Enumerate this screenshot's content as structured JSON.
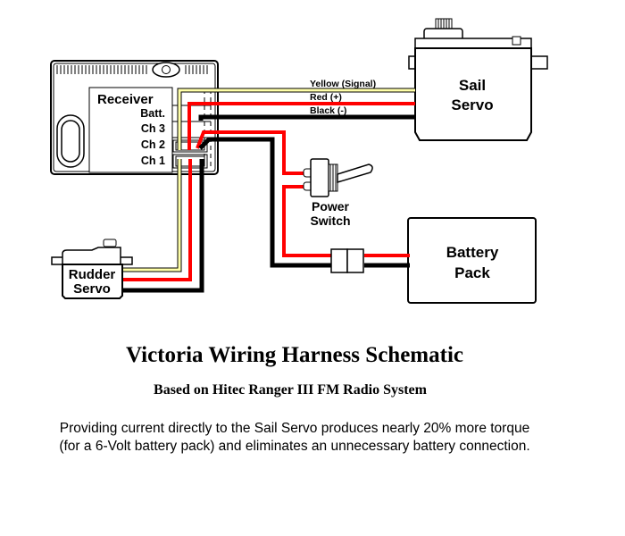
{
  "diagram": {
    "receiver": {
      "label": "Receiver",
      "ports": [
        "Batt.",
        "Ch 3",
        "Ch 2",
        "Ch 1"
      ]
    },
    "sail_servo": {
      "line1": "Sail",
      "line2": "Servo"
    },
    "rudder_servo": {
      "line1": "Rudder",
      "line2": "Servo"
    },
    "battery": {
      "line1": "Battery",
      "line2": "Pack"
    },
    "switch": {
      "line1": "Power",
      "line2": "Switch"
    },
    "wire_labels": {
      "signal": "Yellow (Signal)",
      "positive": "Red (+)",
      "negative": "Black (-)"
    },
    "colors": {
      "signal": "#ffffa8",
      "positive": "#ff0000",
      "negative": "#000000"
    }
  },
  "title": "Victoria Wiring Harness Schematic",
  "subtitle": "Based on Hitec Ranger III FM Radio System",
  "note_line1": "Providing current directly to the Sail Servo produces nearly 20% more torque",
  "note_line2": "(for a 6-Volt battery pack) and eliminates an unnecessary battery connection."
}
